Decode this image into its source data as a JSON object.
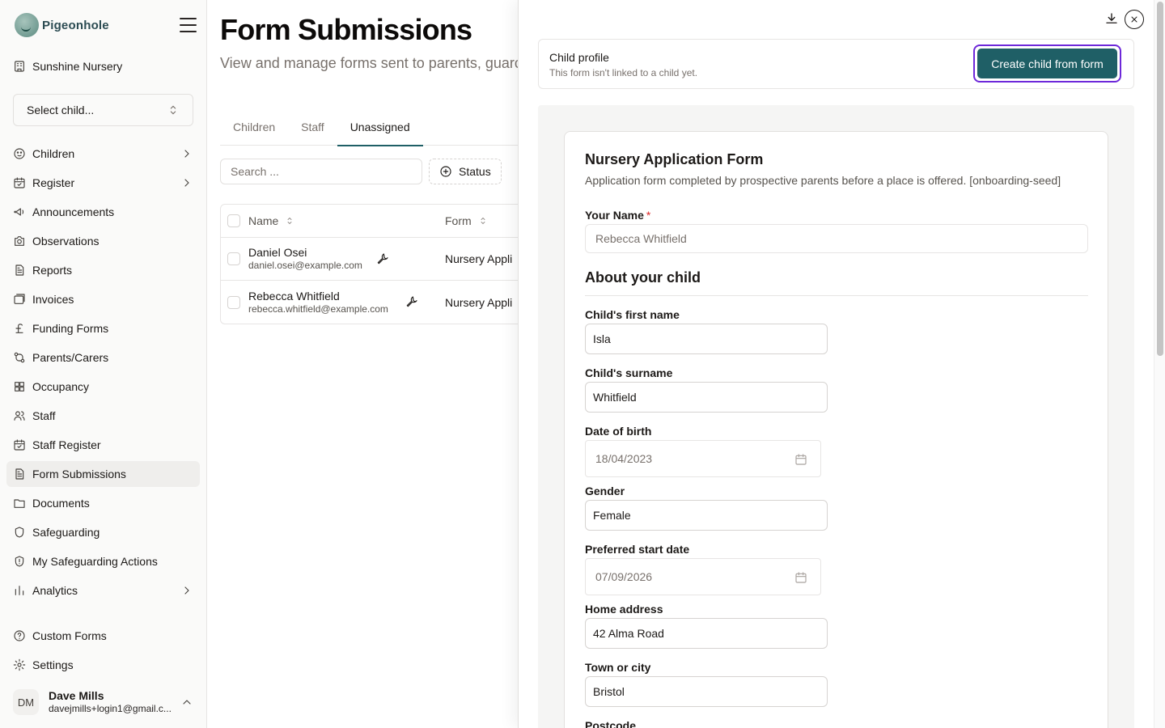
{
  "app": {
    "brand": "Pigeonhole",
    "organization": "Sunshine Nursery"
  },
  "sidebar": {
    "child_select": "Select child...",
    "items": [
      {
        "label": "Children",
        "icon": "children-icon",
        "has_chevron": true
      },
      {
        "label": "Register",
        "icon": "register-icon",
        "has_chevron": true
      },
      {
        "label": "Announcements",
        "icon": "megaphone-icon",
        "has_chevron": false
      },
      {
        "label": "Observations",
        "icon": "camera-icon",
        "has_chevron": false
      },
      {
        "label": "Reports",
        "icon": "document-icon",
        "has_chevron": false
      },
      {
        "label": "Invoices",
        "icon": "invoice-icon",
        "has_chevron": false
      },
      {
        "label": "Funding Forms",
        "icon": "pound-icon",
        "has_chevron": false
      },
      {
        "label": "Parents/Carers",
        "icon": "parents-icon",
        "has_chevron": false
      },
      {
        "label": "Occupancy",
        "icon": "grid-icon",
        "has_chevron": false
      },
      {
        "label": "Staff",
        "icon": "users-icon",
        "has_chevron": false
      },
      {
        "label": "Staff Register",
        "icon": "calendar-check-icon",
        "has_chevron": false
      },
      {
        "label": "Form Submissions",
        "icon": "form-icon",
        "has_chevron": false,
        "active": true
      },
      {
        "label": "Documents",
        "icon": "folder-icon",
        "has_chevron": false
      },
      {
        "label": "Safeguarding",
        "icon": "shield-icon",
        "has_chevron": false
      },
      {
        "label": "My Safeguarding Actions",
        "icon": "shield-alert-icon",
        "has_chevron": false
      },
      {
        "label": "Analytics",
        "icon": "bar-chart-icon",
        "has_chevron": true
      }
    ],
    "bottom_items": [
      {
        "label": "Custom Forms",
        "icon": "help-circle-icon"
      },
      {
        "label": "Settings",
        "icon": "gear-icon"
      }
    ],
    "user": {
      "initials": "DM",
      "name": "Dave Mills",
      "email": "davejmills+login1@gmail.c..."
    }
  },
  "main": {
    "title": "Form Submissions",
    "subtitle": "View and manage forms sent to parents, guarc",
    "tabs": [
      {
        "label": "Children",
        "active": false
      },
      {
        "label": "Staff",
        "active": false
      },
      {
        "label": "Unassigned",
        "active": true
      }
    ],
    "search_placeholder": "Search ...",
    "status_filter": "Status",
    "table": {
      "columns": [
        "Name",
        "Form"
      ],
      "rows": [
        {
          "name": "Daniel Osei",
          "email": "daniel.osei@example.com",
          "form": "Nursery Appli"
        },
        {
          "name": "Rebecca Whitfield",
          "email": "rebecca.whitfield@example.com",
          "form": "Nursery Appli"
        }
      ]
    }
  },
  "sheet": {
    "profile": {
      "title": "Child profile",
      "subtitle": "This form isn't linked to a child yet.",
      "create_button": "Create child from form"
    },
    "form": {
      "title": "Nursery Application Form",
      "description": "Application form completed by prospective parents before a place is offered. [onboarding-seed]",
      "your_name": {
        "label": "Your Name",
        "required": "*",
        "value": "Rebecca Whitfield"
      },
      "section_title": "About your child",
      "fields": {
        "first_name": {
          "label": "Child's first name",
          "value": "Isla"
        },
        "surname": {
          "label": "Child's surname",
          "value": "Whitfield"
        },
        "dob": {
          "label": "Date of birth",
          "value": "18/04/2023"
        },
        "gender": {
          "label": "Gender",
          "value": "Female"
        },
        "start_date": {
          "label": "Preferred start date",
          "value": "07/09/2026"
        },
        "address": {
          "label": "Home address",
          "value": "42 Alma Road"
        },
        "town": {
          "label": "Town or city",
          "value": "Bristol"
        },
        "postcode": {
          "label": "Postcode"
        }
      }
    }
  },
  "colors": {
    "accent": "#1f5f66",
    "focus_ring": "#6d28d9",
    "required": "#dc2626"
  }
}
